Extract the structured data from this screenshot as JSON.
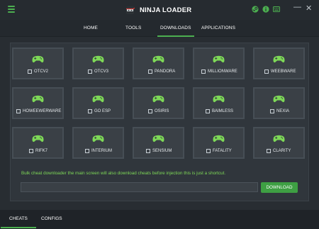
{
  "app": {
    "title": "NINJA LOADER",
    "accent_color": "#4caf50",
    "text_color": "#7ed957",
    "title_icons": [
      "steam-icon",
      "info-icon",
      "keyboard-icon"
    ],
    "window_controls": {
      "minimize": "—",
      "close": "✕"
    }
  },
  "nav": {
    "tabs": [
      {
        "label": "HOME",
        "active": false
      },
      {
        "label": "TOOLS",
        "active": false
      },
      {
        "label": "DOWNLOADS",
        "active": true
      },
      {
        "label": "APPLICATIONS",
        "active": false
      }
    ]
  },
  "cheats": [
    {
      "label": "OTCV2",
      "checked": false,
      "icon": "gamepad-icon"
    },
    {
      "label": "OTCV3",
      "checked": false,
      "icon": "gamepad-icon"
    },
    {
      "label": "PANDORA",
      "checked": false,
      "icon": "gamepad-icon"
    },
    {
      "label": "MILLIONWARE",
      "checked": false,
      "icon": "gamepad-icon"
    },
    {
      "label": "WEEBWARE",
      "checked": false,
      "icon": "gamepad-icon"
    },
    {
      "label": "HOWEEWERWARE",
      "checked": false,
      "icon": "gamepad-icon"
    },
    {
      "label": "GO ESP",
      "checked": false,
      "icon": "gamepad-icon"
    },
    {
      "label": "OSIRIS",
      "checked": false,
      "icon": "gamepad-icon"
    },
    {
      "label": "BAIMLESS",
      "checked": false,
      "icon": "gamepad-icon"
    },
    {
      "label": "NEXIA",
      "checked": false,
      "icon": "gamepad-icon"
    },
    {
      "label": "RIFK7",
      "checked": false,
      "icon": "gamepad-icon"
    },
    {
      "label": "INTERIUM",
      "checked": false,
      "icon": "gamepad-icon"
    },
    {
      "label": "SENSIUM",
      "checked": false,
      "icon": "gamepad-icon"
    },
    {
      "label": "FATALITY",
      "checked": false,
      "icon": "gamepad-icon"
    },
    {
      "label": "CLARITY",
      "checked": false,
      "icon": "gamepad-icon"
    }
  ],
  "bulk": {
    "description": "Bulk cheat downloader the main screen will also download cheats before injection this is just a shortcut.",
    "input_value": "",
    "download_label": "DOWNLOAD"
  },
  "bottom_tabs": [
    {
      "label": "CHEATS",
      "active": true
    },
    {
      "label": "CONFIGS",
      "active": false
    }
  ]
}
